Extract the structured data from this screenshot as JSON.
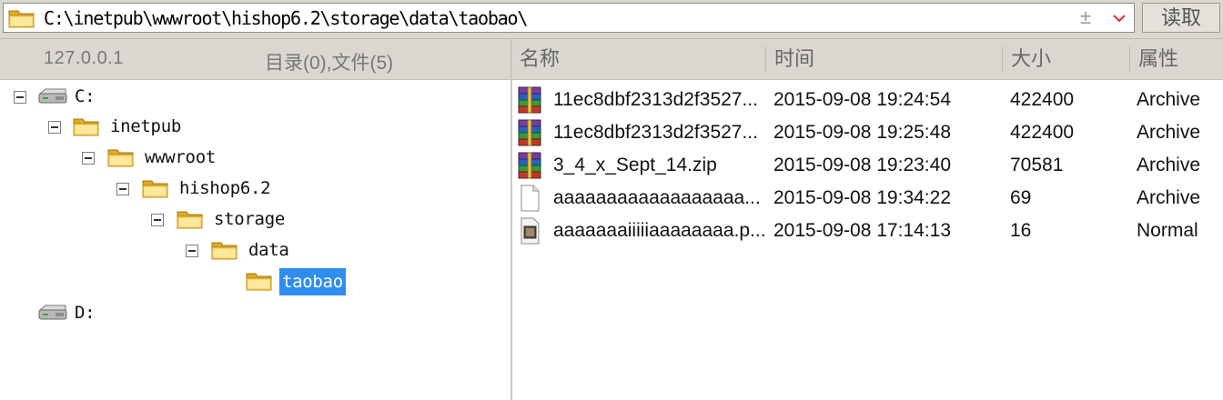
{
  "path": {
    "value": "C:\\inetpub\\wwwroot\\hishop6.2\\storage\\data\\taobao\\",
    "read_button": "读取",
    "pm_glyph": "±"
  },
  "left_header": {
    "host": "127.0.0.1",
    "counts": "目录(0),文件(5)"
  },
  "columns": {
    "name": "名称",
    "time": "时间",
    "size": "大小",
    "attr": "属性"
  },
  "tree": [
    {
      "label": "C:",
      "type": "drive",
      "level": 0,
      "expanded": true
    },
    {
      "label": "inetpub",
      "type": "folder",
      "level": 1,
      "expanded": true
    },
    {
      "label": "wwwroot",
      "type": "folder",
      "level": 2,
      "expanded": true
    },
    {
      "label": "hishop6.2",
      "type": "folder",
      "level": 3,
      "expanded": true
    },
    {
      "label": "storage",
      "type": "folder",
      "level": 4,
      "expanded": true
    },
    {
      "label": "data",
      "type": "folder",
      "level": 5,
      "expanded": true
    },
    {
      "label": "taobao",
      "type": "folder",
      "level": 6,
      "selected": true
    },
    {
      "label": "D:",
      "type": "drive",
      "level": 0
    }
  ],
  "files": [
    {
      "name": "11ec8dbf2313d2f3527...",
      "time": "2015-09-08 19:24:54",
      "size": "422400",
      "attr": "Archive",
      "icon": "winrar-archive-icon"
    },
    {
      "name": "11ec8dbf2313d2f3527...",
      "time": "2015-09-08 19:25:48",
      "size": "422400",
      "attr": "Archive",
      "icon": "winrar-archive-icon"
    },
    {
      "name": "3_4_x_Sept_14.zip",
      "time": "2015-09-08 19:23:40",
      "size": "70581",
      "attr": "Archive",
      "icon": "winrar-archive-icon"
    },
    {
      "name": "aaaaaaaaaaaaaaaaaa...",
      "time": "2015-09-08 19:34:22",
      "size": "69",
      "attr": "Archive",
      "icon": "blank-file-icon"
    },
    {
      "name": "aaaaaaaiiiiiaaaaaaaa.p...",
      "time": "2015-09-08 17:14:13",
      "size": "16",
      "attr": "Normal",
      "icon": "image-file-icon"
    }
  ],
  "colors": {
    "selection": "#2f8cf0",
    "header_bg": "#d9d7d0",
    "folder": "#f5c542"
  }
}
